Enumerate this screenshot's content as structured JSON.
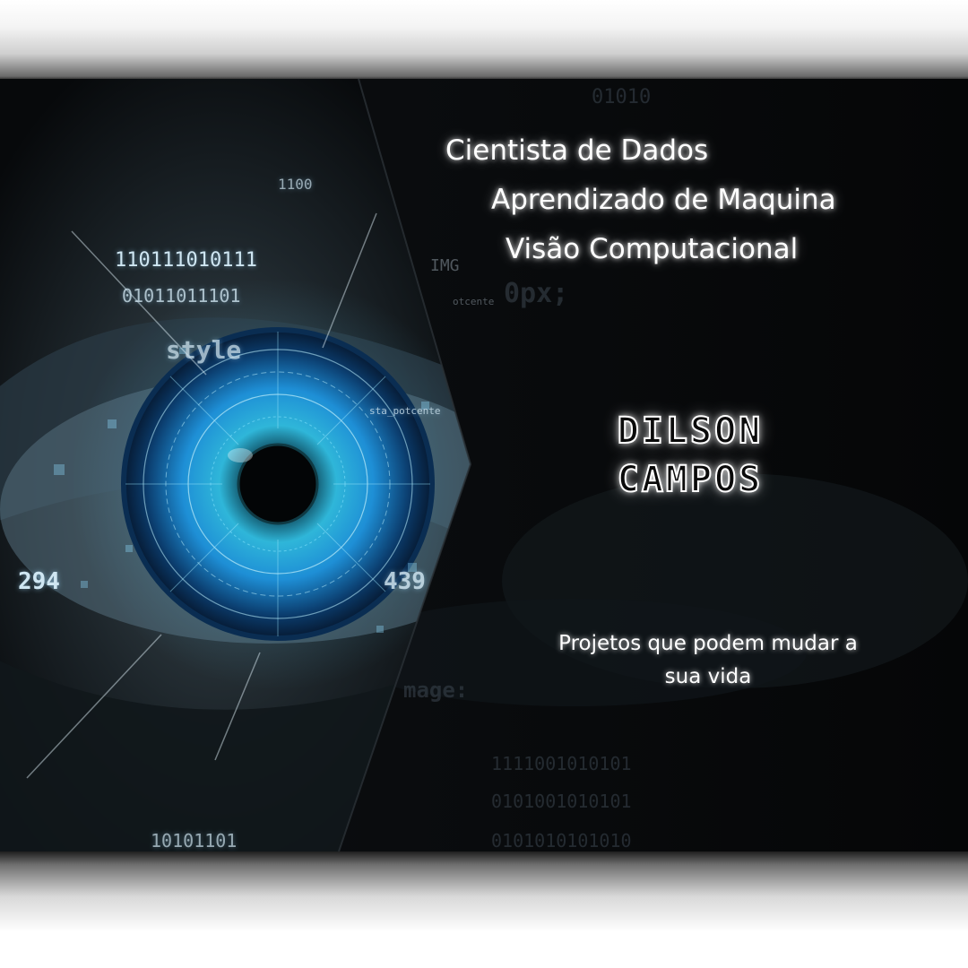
{
  "taglines": [
    "Cientista de Dados",
    "Aprendizado  de Maquina",
    "Visão Computacional"
  ],
  "name": {
    "first": "DILSON",
    "last": "CAMPOS"
  },
  "subtitle": {
    "line1": "Projetos que podem mudar a",
    "line2": "sua vida"
  },
  "background_text": {
    "binary_top": "01010",
    "img": "IMG",
    "px": "0px;",
    "potcente": "otcente",
    "binary_lower_1": "1111001010101",
    "binary_lower_2": "0101001010101",
    "binary_lower_3": "0101010101010",
    "image": "mage:",
    "eye_binary_1": "110111010111",
    "eye_binary_2": "01011011101",
    "eye_style": "style",
    "eye_num_1": "294",
    "eye_num_2": "439",
    "eye_sta": "sta_potcente",
    "eye_bottom_binary": "10101101",
    "eye_top_binary": "1100"
  },
  "colors": {
    "background": "#080a0c",
    "iris_light": "#7fe3ff",
    "iris_mid": "#1e8fd6",
    "iris_dark": "#0b3d6e",
    "text_glow": "#ffffff"
  }
}
